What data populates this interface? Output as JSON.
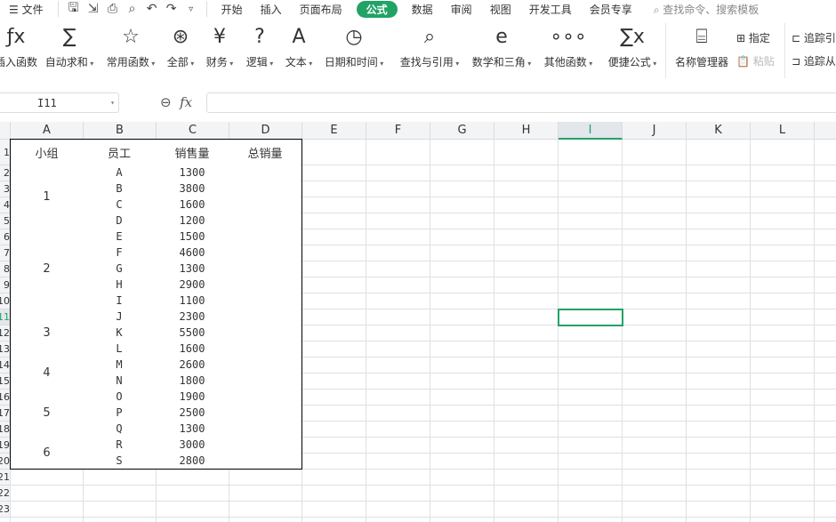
{
  "menubar": {
    "file": "文件",
    "tabs": [
      "开始",
      "插入",
      "页面布局",
      "公式",
      "数据",
      "审阅",
      "视图",
      "开发工具",
      "会员专享"
    ],
    "active_tab": "公式",
    "search_placeholder": "查找命令、搜索模板"
  },
  "ribbon": {
    "buttons": [
      {
        "label": "插入函数",
        "icon": "fx-icon",
        "glyph": "ƒx",
        "dd": false
      },
      {
        "label": "自动求和",
        "icon": "sigma-icon",
        "glyph": "∑",
        "dd": true
      },
      {
        "label": "常用函数",
        "icon": "star-icon",
        "glyph": "☆",
        "dd": true
      },
      {
        "label": "全部",
        "icon": "asterisk-icon",
        "glyph": "⊛",
        "dd": true
      },
      {
        "label": "财务",
        "icon": "yen-book-icon",
        "glyph": "¥",
        "dd": true
      },
      {
        "label": "逻辑",
        "icon": "question-book-icon",
        "glyph": "?",
        "dd": true
      },
      {
        "label": "文本",
        "icon": "text-book-icon",
        "glyph": "A",
        "dd": true
      },
      {
        "label": "日期和时间",
        "icon": "clock-book-icon",
        "glyph": "◷",
        "dd": true
      },
      {
        "label": "查找与引用",
        "icon": "search-book-icon",
        "glyph": "⌕",
        "dd": true
      },
      {
        "label": "数学和三角",
        "icon": "math-book-icon",
        "glyph": "e",
        "dd": true
      },
      {
        "label": "其他函数",
        "icon": "more-icon",
        "glyph": "∘∘∘",
        "dd": true
      },
      {
        "label": "便捷公式",
        "icon": "quick-formula-icon",
        "glyph": "∑x",
        "dd": true
      },
      {
        "label": "名称管理器",
        "icon": "name-manager-icon",
        "glyph": "⌸",
        "dd": false
      }
    ],
    "assign": "指定",
    "paste": "粘贴",
    "trace1": "追踪引",
    "trace2": "追踪从"
  },
  "formula_bar": {
    "name_box": "I11",
    "fx": "fx",
    "value": ""
  },
  "sheet": {
    "columns": [
      "A",
      "B",
      "C",
      "D",
      "E",
      "F",
      "G",
      "H",
      "I",
      "J",
      "K",
      "L"
    ],
    "selected_column": "I",
    "selected_cell": "I11",
    "headers": [
      "小组",
      "员工",
      "销售量",
      "总销量"
    ],
    "groups": [
      {
        "group": "1",
        "rows": [
          [
            "A",
            "1300"
          ],
          [
            "B",
            "3800"
          ],
          [
            "C",
            "1600"
          ],
          [
            "D",
            "1200"
          ]
        ]
      },
      {
        "group": "2",
        "rows": [
          [
            "E",
            "1500"
          ],
          [
            "F",
            "4600"
          ],
          [
            "G",
            "1300"
          ],
          [
            "H",
            "2900"
          ],
          [
            "I",
            "1100"
          ]
        ]
      },
      {
        "group": "3",
        "rows": [
          [
            "J",
            "2300"
          ],
          [
            "K",
            "5500"
          ],
          [
            "L",
            "1600"
          ]
        ]
      },
      {
        "group": "4",
        "rows": [
          [
            "M",
            "2600"
          ],
          [
            "N",
            "1800"
          ]
        ]
      },
      {
        "group": "5",
        "rows": [
          [
            "O",
            "1900"
          ],
          [
            "P",
            "2500"
          ],
          [
            "Q",
            "1300"
          ]
        ]
      },
      {
        "group": "6",
        "rows": [
          [
            "R",
            "3000"
          ],
          [
            "S",
            "2800"
          ]
        ]
      }
    ]
  },
  "colors": {
    "accent": "#21a366"
  }
}
